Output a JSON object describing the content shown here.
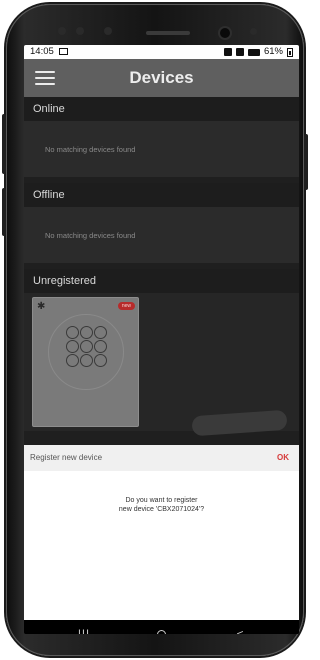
{
  "status_bar": {
    "time": "14:05",
    "battery_text": "61%"
  },
  "app": {
    "title": "Devices",
    "sections": {
      "online": {
        "header": "Online",
        "empty_text": "No matching devices found"
      },
      "offline": {
        "header": "Offline",
        "empty_text": "No matching devices found"
      },
      "unregistered": {
        "header": "Unregistered"
      }
    },
    "device_card": {
      "badge": "new",
      "icon": "bluetooth-icon"
    }
  },
  "dialog": {
    "title": "Register new device",
    "ok_label": "OK",
    "message_line1": "Do you want to register",
    "message_line2": "new device 'CBX2071024'?"
  },
  "nav": {
    "recents": "|||",
    "back": "<"
  },
  "colors": {
    "accent": "#d63a3a",
    "badge": "#b72b2b",
    "topbar": "#5f5f5f"
  }
}
